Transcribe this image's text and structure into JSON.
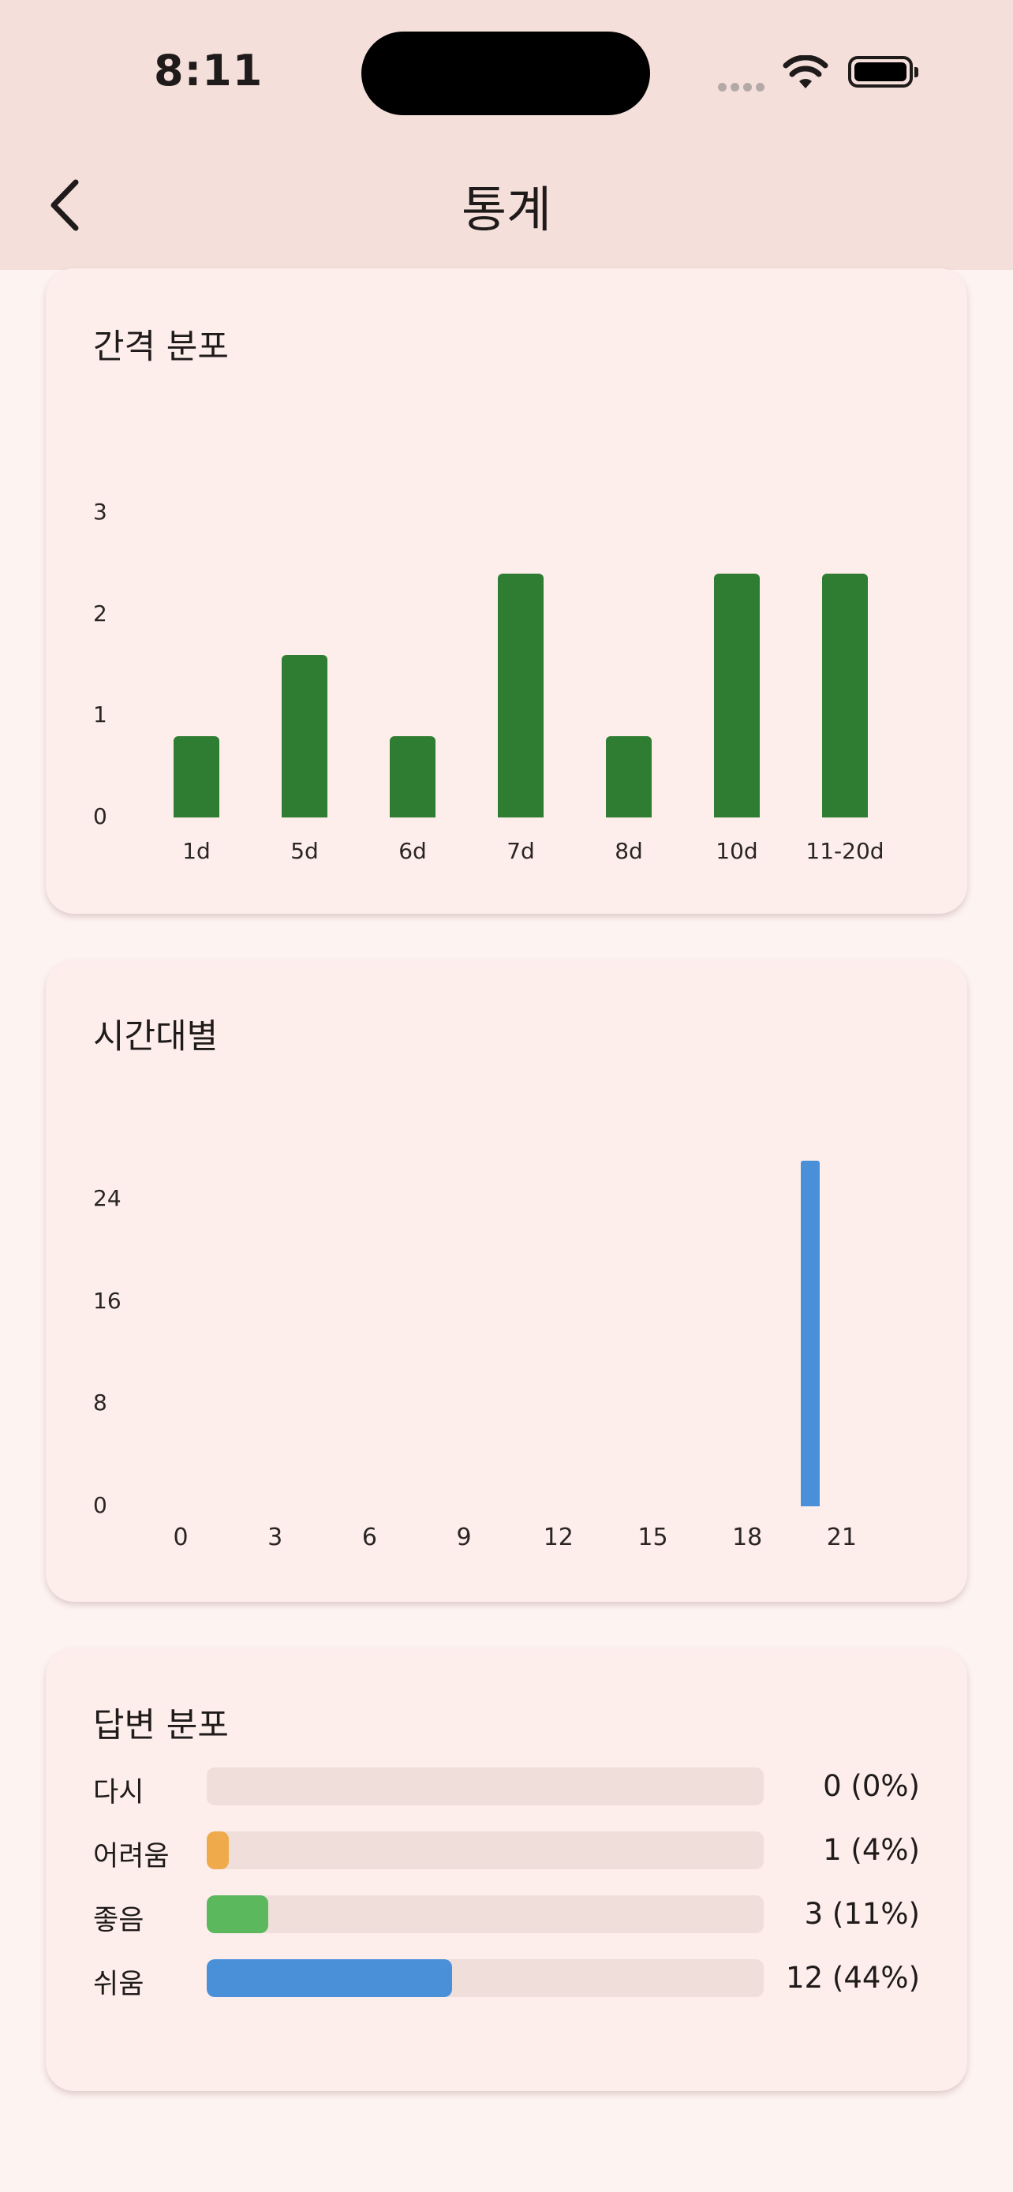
{
  "status_bar": {
    "time": "8:11"
  },
  "app_bar": {
    "title": "통계"
  },
  "interval_chart": {
    "title": "간격 분포",
    "chart_data": {
      "type": "bar",
      "categories": [
        "1d",
        "5d",
        "6d",
        "7d",
        "8d",
        "10d",
        "11-20d"
      ],
      "values": [
        0.8,
        1.6,
        0.8,
        2.4,
        0.8,
        2.4,
        2.4
      ],
      "yticks": [
        "0",
        "1",
        "2",
        "3"
      ],
      "ylim": [
        0,
        3
      ],
      "color": "#2e7d32"
    }
  },
  "hourly_chart": {
    "title": "시간대별",
    "chart_data": {
      "type": "bar",
      "x": [
        20
      ],
      "values": [
        27
      ],
      "xticks": [
        "0",
        "3",
        "6",
        "9",
        "12",
        "15",
        "18",
        "21"
      ],
      "yticks": [
        "0",
        "8",
        "16",
        "24"
      ],
      "ylim": [
        0,
        24
      ],
      "xlim": [
        0,
        23
      ],
      "color": "#4a90d9"
    }
  },
  "answer_dist": {
    "title": "답변 분포",
    "rows": [
      {
        "label": "다시",
        "value": "0 (0%)",
        "fraction": 0.0,
        "color": "#e57373"
      },
      {
        "label": "어려움",
        "value": "1 (4%)",
        "fraction": 0.04,
        "color": "#efaa4b"
      },
      {
        "label": "좋음",
        "value": "3 (11%)",
        "fraction": 0.11,
        "color": "#5cb85c"
      },
      {
        "label": "쉬움",
        "value": "12 (44%)",
        "fraction": 0.44,
        "color": "#4a90d9"
      }
    ]
  }
}
